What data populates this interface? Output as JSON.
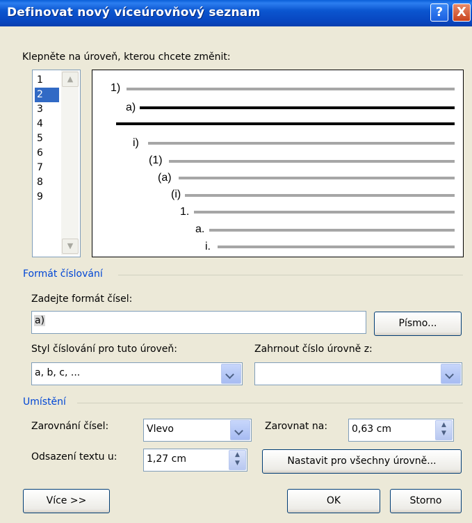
{
  "dialog": {
    "title": "Definovat nový víceúrovňový seznam",
    "help_label": "?",
    "close_label": "X"
  },
  "levels_prompt": "Klepněte na úroveň, kterou chcete změnit:",
  "levels": [
    "1",
    "2",
    "3",
    "4",
    "5",
    "6",
    "7",
    "8",
    "9"
  ],
  "selected_level": "2",
  "preview": {
    "labels": [
      "1)",
      "a)",
      "i)",
      "(1)",
      "(a)",
      "(i)",
      "1.",
      "a.",
      "i."
    ]
  },
  "numbering_format": {
    "group_title": "Formát číslování",
    "format_label": "Zadejte formát čísel:",
    "format_value": "a)",
    "font_button": "Písmo...",
    "style_label": "Styl číslování pro tuto úroveň:",
    "style_value": "a, b, c, ...",
    "include_level_label": "Zahrnout číslo úrovně z:",
    "include_level_value": ""
  },
  "position": {
    "group_title": "Umístění",
    "alignment_label": "Zarovnání čísel:",
    "alignment_value": "Vlevo",
    "align_at_label": "Zarovnat na:",
    "align_at_value": "0,63 cm",
    "indent_label": "Odsazení textu u:",
    "indent_value": "1,27 cm",
    "set_all_button": "Nastavit pro všechny úrovně..."
  },
  "buttons": {
    "more": "Více >>",
    "ok": "OK",
    "cancel": "Storno"
  },
  "colors": {
    "titlebar": "#0846c0",
    "group_title": "#0046d5",
    "selection": "#316ac5"
  }
}
